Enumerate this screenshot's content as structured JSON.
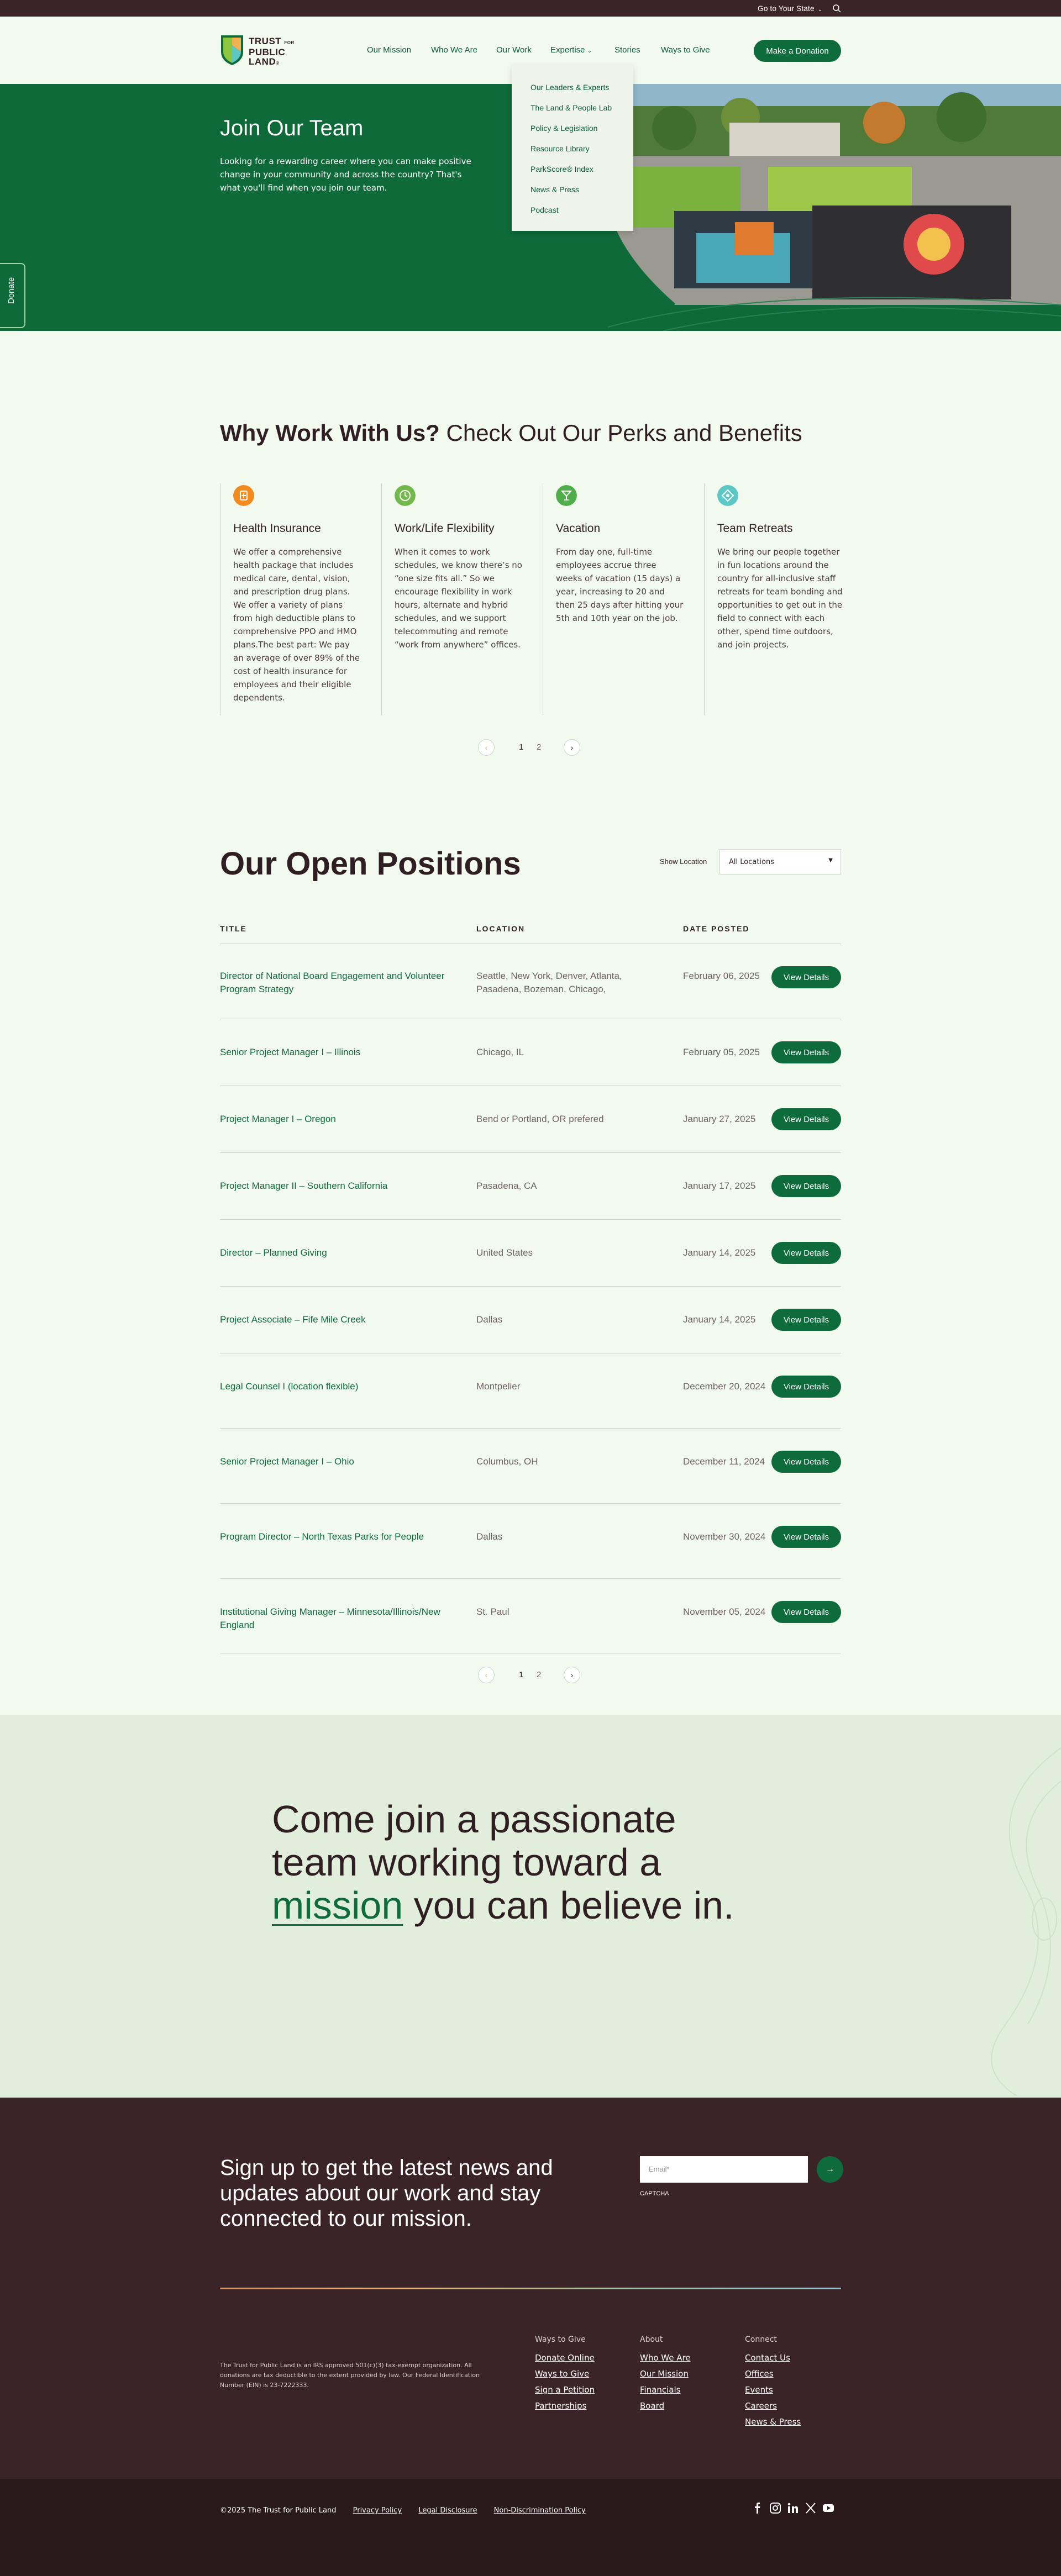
{
  "util": {
    "state_label": "Go to Your State"
  },
  "header": {
    "logo": {
      "line1": "TRUST",
      "for": "FOR",
      "line2": "PUBLIC",
      "line3": "LAND"
    },
    "nav": [
      "Our Mission",
      "Who We Are",
      "Our Work",
      "Expertise",
      "Stories",
      "Ways to Give"
    ],
    "cta": "Make a Donation"
  },
  "dropdown": [
    "Our Leaders & Experts",
    "The Land & People Lab",
    "Policy & Legislation",
    "Resource Library",
    "ParkScore® Index",
    "News & Press",
    "Podcast"
  ],
  "hero": {
    "title": "Join Our Team",
    "text": "Looking for a rewarding career where you can make positive change in your community and across the country? That's what you'll find when you join our team."
  },
  "sidetab": {
    "label": "Donate"
  },
  "perks": {
    "title_bold": "Why Work With Us?",
    "title_rest": " Check Out Our Perks and Benefits",
    "items": [
      {
        "title": "Health Insurance",
        "text": "We offer a comprehensive health package that includes medical care, dental, vision, and prescription drug plans. We offer a variety of plans from high deductible plans to comprehensive PPO and HMO plans.The best part: We pay an average of over 89% of the cost of health insurance for employees and their eligible dependents.",
        "icon": "medical-icon",
        "color": "#f28a1e"
      },
      {
        "title": "Work/Life Flexibility",
        "text": "When it comes to work schedules, we know there’s no “one size fits all.” So we encourage flexibility in work hours, alternate and hybrid schedules, and we support telecommuting and remote “work from anywhere” offices.",
        "icon": "flexibility-icon",
        "color": "#72b84a"
      },
      {
        "title": "Vacation",
        "text": "From day one, full-time employees accrue three weeks of vacation (15 days) a year, increasing to 20 and then 25 days after hitting your 5th and 10th year on the job.",
        "icon": "cocktail-icon",
        "color": "#4fae4a"
      },
      {
        "title": "Team Retreats",
        "text": "We bring our people together in fun locations around the country for all-inclusive staff retreats for team bonding and opportunities to get out in the field to connect with each other, spend time outdoors, and join projects.",
        "icon": "retreat-icon",
        "color": "#5cc7c4"
      }
    ],
    "pages": [
      "1",
      "2"
    ]
  },
  "positions": {
    "title": "Our Open Positions",
    "show_location": "Show Location",
    "location_value": "All Locations",
    "headers": [
      "TITLE",
      "LOCATION",
      "DATE POSTED"
    ],
    "button": "View Details",
    "rows": [
      {
        "title": "Director of National Board Engagement and Volunteer Program Strategy",
        "location": "Seattle, New York, Denver, Atlanta, Pasadena, Bozeman, Chicago,",
        "date": "February 06, 2025"
      },
      {
        "title": "Senior Project Manager I – Illinois",
        "location": "Chicago, IL",
        "date": "February 05, 2025"
      },
      {
        "title": "Project Manager I – Oregon",
        "location": "Bend or Portland, OR prefered",
        "date": "January 27, 2025"
      },
      {
        "title": "Project Manager II – Southern California",
        "location": "Pasadena, CA",
        "date": "January 17, 2025"
      },
      {
        "title": "Director – Planned Giving",
        "location": "United States",
        "date": "January 14, 2025"
      },
      {
        "title": "Project Associate – Fife Mile Creek",
        "location": "Dallas",
        "date": "January 14, 2025"
      },
      {
        "title": "Legal Counsel I (location flexible)",
        "location": "Montpelier",
        "date": "December 20, 2024"
      },
      {
        "title": "Senior Project Manager I – Ohio",
        "location": "Columbus, OH",
        "date": "December 11, 2024"
      },
      {
        "title": "Program Director – North Texas Parks for People",
        "location": "Dallas",
        "date": "November 30, 2024"
      },
      {
        "title": "Institutional Giving Manager – Minnesota/Illinois/New England",
        "location": "St. Paul",
        "date": "November 05, 2024"
      }
    ],
    "pages": [
      "1",
      "2"
    ]
  },
  "cta": {
    "line1": "Come join a passionate",
    "line2": "team working toward a",
    "highlight": "mission",
    "line3_rest": " you can believe in."
  },
  "footer": {
    "signup": "Sign up to get the latest news and updates about our work and stay connected to our mission.",
    "email_placeholder": "Email*",
    "captcha": "CAPTCHA",
    "legal": "The Trust for Public Land is an IRS approved 501(c)(3) tax-exempt organization. All donations are tax deductible to the extent provided by law. Our Federal Identification Number (EIN) is 23-7222333.",
    "columns": [
      {
        "heading": "Ways to Give",
        "links": [
          "Donate Online",
          "Ways to Give",
          "Sign a Petition",
          "Partnerships"
        ]
      },
      {
        "heading": "About",
        "links": [
          "Who We Are",
          "Our Mission",
          "Financials",
          "Board"
        ]
      },
      {
        "heading": "Connect",
        "links": [
          "Contact Us",
          "Offices",
          "Events",
          "Careers",
          "News & Press"
        ]
      }
    ],
    "copyright": "©2025 The Trust for Public Land",
    "bottom_links": [
      "Privacy Policy",
      "Legal Disclosure",
      "Non-Discrimination Policy"
    ]
  }
}
